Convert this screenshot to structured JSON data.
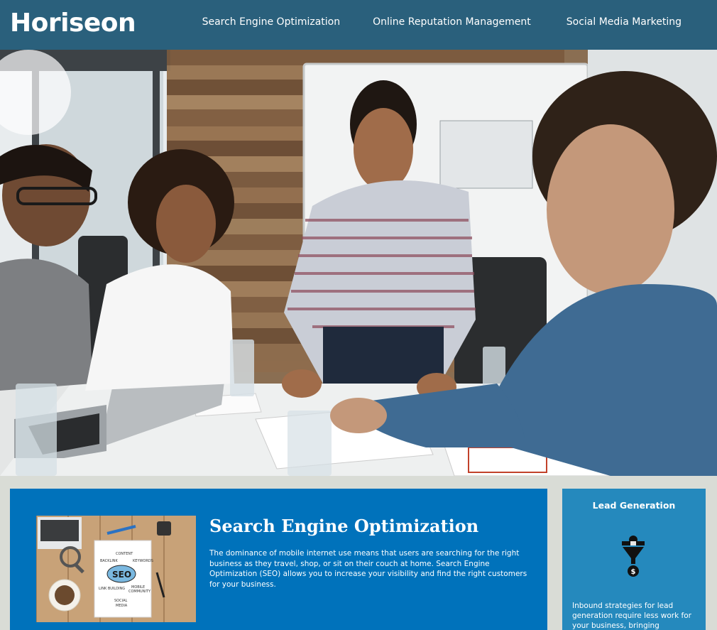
{
  "header": {
    "brand": "Horiseon",
    "nav": [
      {
        "label": "Search Engine Optimization"
      },
      {
        "label": "Online Reputation Management"
      },
      {
        "label": "Social Media Marketing"
      }
    ]
  },
  "main": {
    "section": {
      "title": "Search Engine Optimization",
      "text": "The dominance of mobile internet use means that users are searching for the right business as they travel, shop, or sit on their couch at home. Search Engine Optimization (SEO) allows you to increase your visibility and find the right customers for your business.",
      "image_words": [
        "CONTENT",
        "BACKLINK",
        "KEYWORDS",
        "SEO",
        "MOBILE",
        "COMMUNITY",
        "LINK BUILDING",
        "SOCIAL",
        "MEDIA"
      ]
    }
  },
  "aside": {
    "title": "Lead Generation",
    "icon": "lead-funnel-icon",
    "text": "Inbound strategies for lead generation require less work for your business, bringing customers"
  },
  "colors": {
    "header_bg": "#2a607c",
    "page_bg": "#d9dcd6",
    "main_bg": "#0072bb",
    "aside_bg": "#2589bd"
  }
}
